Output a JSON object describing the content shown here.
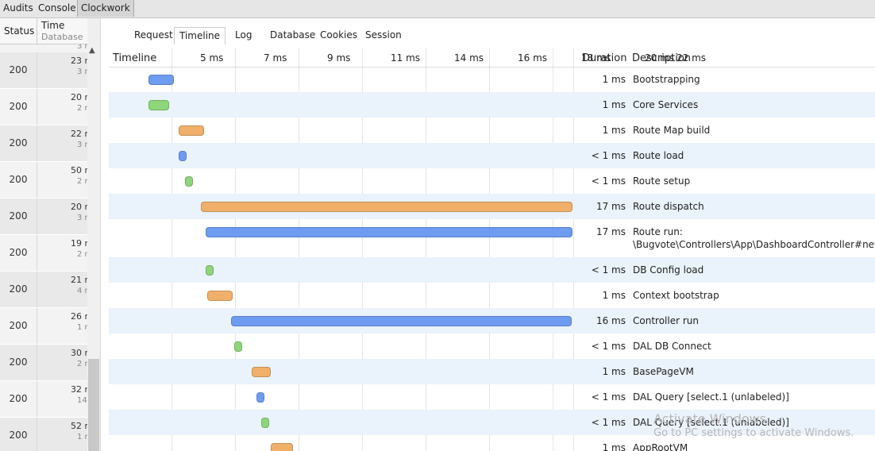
{
  "top_tabs": [
    {
      "label": "Audits"
    },
    {
      "label": "Console"
    },
    {
      "label": "Clockwork"
    }
  ],
  "requests": {
    "headers": {
      "status": "Status",
      "time": "Time",
      "database": "Database"
    },
    "partial_top": {
      "db": "3 r"
    },
    "rows": [
      {
        "status": "200",
        "time": "23 r",
        "db": "3 r"
      },
      {
        "status": "200",
        "time": "20 r",
        "db": "2 r"
      },
      {
        "status": "200",
        "time": "22 r",
        "db": "3 r"
      },
      {
        "status": "200",
        "time": "50 r",
        "db": "2 r"
      },
      {
        "status": "200",
        "time": "20 r",
        "db": "3 r"
      },
      {
        "status": "200",
        "time": "19 r",
        "db": "2 r"
      },
      {
        "status": "200",
        "time": "21 r",
        "db": "4 r"
      },
      {
        "status": "200",
        "time": "26 r",
        "db": "1 r"
      },
      {
        "status": "200",
        "time": "30 r",
        "db": "2 r"
      },
      {
        "status": "200",
        "time": "32 r",
        "db": "14 r"
      },
      {
        "status": "200",
        "time": "52 r",
        "db": "1 r"
      }
    ]
  },
  "sub_tabs": [
    {
      "label": "Request"
    },
    {
      "label": "Timeline"
    },
    {
      "label": "Log"
    },
    {
      "label": "Database"
    },
    {
      "label": "Cookies"
    },
    {
      "label": "Session"
    }
  ],
  "timeline": {
    "headers": {
      "timeline": "Timeline",
      "duration": "Duration",
      "description": "Description"
    },
    "ticks": [
      "5 ms",
      "7 ms",
      "9 ms",
      "11 ms",
      "14 ms",
      "16 ms",
      "18 ms",
      "20 ms",
      "22 ms"
    ],
    "colors": {
      "blue": "#6e9cf0",
      "green": "#8ed67a",
      "orange": "#f0b06a"
    },
    "events": [
      {
        "start": 0.65,
        "end": 1.4,
        "color": "blue",
        "duration": "1 ms",
        "description": "Bootstrapping"
      },
      {
        "start": 0.65,
        "end": 1.25,
        "color": "green",
        "duration": "1 ms",
        "description": "Core Services"
      },
      {
        "start": 1.6,
        "end": 2.35,
        "color": "orange",
        "duration": "1 ms",
        "description": "Route Map build"
      },
      {
        "start": 1.6,
        "end": 1.8,
        "color": "blue",
        "duration": "< 1 ms",
        "description": "Route load"
      },
      {
        "start": 1.8,
        "end": 2.0,
        "color": "green",
        "duration": "< 1 ms",
        "description": "Route setup"
      },
      {
        "start": 2.3,
        "end": 13.95,
        "color": "orange",
        "duration": "17 ms",
        "description": "Route dispatch"
      },
      {
        "start": 2.45,
        "end": 13.95,
        "color": "blue",
        "duration": "17 ms",
        "description": "Route run:",
        "description2": "\\Bugvote\\Controllers\\App\\DashboardController#new"
      },
      {
        "start": 2.45,
        "end": 2.65,
        "color": "green",
        "duration": "< 1 ms",
        "description": "DB Config load"
      },
      {
        "start": 2.5,
        "end": 3.25,
        "color": "orange",
        "duration": "1 ms",
        "description": "Context bootstrap"
      },
      {
        "start": 3.25,
        "end": 13.92,
        "color": "blue",
        "duration": "16 ms",
        "description": "Controller run"
      },
      {
        "start": 3.35,
        "end": 3.55,
        "color": "green",
        "duration": "< 1 ms",
        "description": "DAL DB Connect"
      },
      {
        "start": 3.9,
        "end": 4.45,
        "color": "orange",
        "duration": "1 ms",
        "description": "BasePageVM"
      },
      {
        "start": 4.05,
        "end": 4.25,
        "color": "blue",
        "duration": "< 1 ms",
        "description": "DAL Query [select.1 (unlabeled)]"
      },
      {
        "start": 4.2,
        "end": 4.4,
        "color": "green",
        "duration": "< 1 ms",
        "description": "DAL Query [select.1 (unlabeled)]"
      },
      {
        "start": 4.5,
        "end": 5.15,
        "color": "orange",
        "duration": "1 ms",
        "description": "AppRootVM"
      }
    ]
  },
  "watermark": {
    "line1": "Activate Windows",
    "line2": "Go to PC settings to activate Windows."
  }
}
